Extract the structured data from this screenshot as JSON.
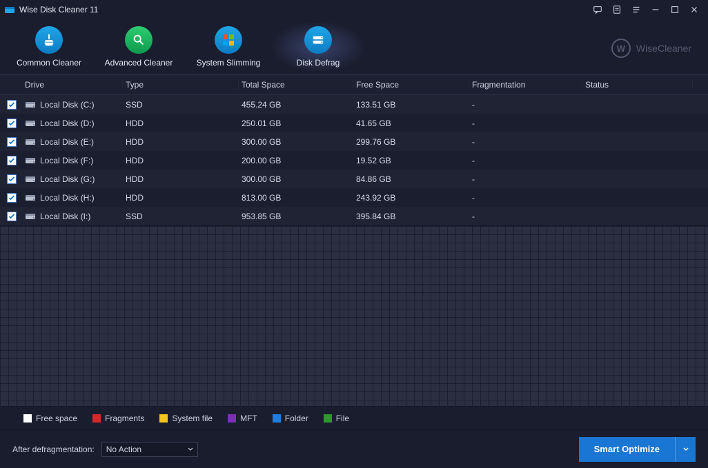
{
  "app": {
    "title": "Wise Disk Cleaner 11",
    "brand": "WiseCleaner",
    "brand_letter": "W"
  },
  "tabs": [
    {
      "label": "Common Cleaner"
    },
    {
      "label": "Advanced Cleaner"
    },
    {
      "label": "System Slimming"
    },
    {
      "label": "Disk Defrag"
    }
  ],
  "columns": {
    "drive": "Drive",
    "type": "Type",
    "total": "Total Space",
    "free": "Free Space",
    "frag": "Fragmentation",
    "status": "Status"
  },
  "rows": [
    {
      "checked": true,
      "name": "Local Disk (C:)",
      "type": "SSD",
      "total": "455.24 GB",
      "free": "133.51 GB",
      "frag": "-",
      "status": ""
    },
    {
      "checked": true,
      "name": "Local Disk (D:)",
      "type": "HDD",
      "total": "250.01 GB",
      "free": "41.65 GB",
      "frag": "-",
      "status": ""
    },
    {
      "checked": true,
      "name": "Local Disk (E:)",
      "type": "HDD",
      "total": "300.00 GB",
      "free": "299.76 GB",
      "frag": "-",
      "status": ""
    },
    {
      "checked": true,
      "name": "Local Disk (F:)",
      "type": "HDD",
      "total": "200.00 GB",
      "free": "19.52 GB",
      "frag": "-",
      "status": ""
    },
    {
      "checked": true,
      "name": "Local Disk (G:)",
      "type": "HDD",
      "total": "300.00 GB",
      "free": "84.86 GB",
      "frag": "-",
      "status": ""
    },
    {
      "checked": true,
      "name": "Local Disk (H:)",
      "type": "HDD",
      "total": "813.00 GB",
      "free": "243.92 GB",
      "frag": "-",
      "status": ""
    },
    {
      "checked": true,
      "name": "Local Disk (I:)",
      "type": "SSD",
      "total": "953.85 GB",
      "free": "395.84 GB",
      "frag": "-",
      "status": ""
    }
  ],
  "legend": [
    {
      "color": "#ffffff",
      "label": "Free space"
    },
    {
      "color": "#d4282a",
      "label": "Fragments"
    },
    {
      "color": "#f4c61b",
      "label": "System file"
    },
    {
      "color": "#7b2fb5",
      "label": "MFT"
    },
    {
      "color": "#1f7de0",
      "label": "Folder"
    },
    {
      "color": "#2a9a2a",
      "label": "File"
    }
  ],
  "footer": {
    "after_label": "After defragmentation:",
    "select_value": "No Action",
    "button": "Smart Optimize"
  }
}
